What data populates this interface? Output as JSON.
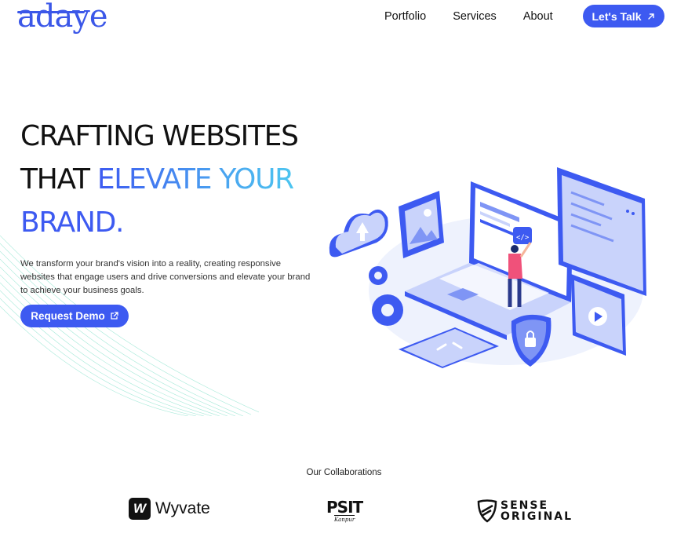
{
  "header": {
    "logo_text": "adaye",
    "nav": [
      "Portfolio",
      "Services",
      "About"
    ],
    "cta_label": "Let's Talk",
    "cta_icon": "arrow-up-right-icon",
    "accent": "#3d5af1"
  },
  "hero": {
    "line1": "CRAFTING WEBSITES",
    "line2_plain": "THAT",
    "line2_gradient": "ELEVATE YOUR",
    "line3": "BRAND.",
    "description": "We transform your brand's vision into a reality, creating responsive websites that engage users and drive conversions and elevate your brand to achieve your business goals.",
    "button_label": "Request Demo",
    "button_icon": "external-link-icon"
  },
  "collaborations": {
    "title": "Our Collaborations",
    "brands": [
      {
        "name": "Wyvate",
        "icon": "W"
      },
      {
        "name": "PSIT",
        "sub": "Kanpur"
      },
      {
        "name_top": "SENSE",
        "name_bottom": "ORIGINAL"
      }
    ]
  }
}
